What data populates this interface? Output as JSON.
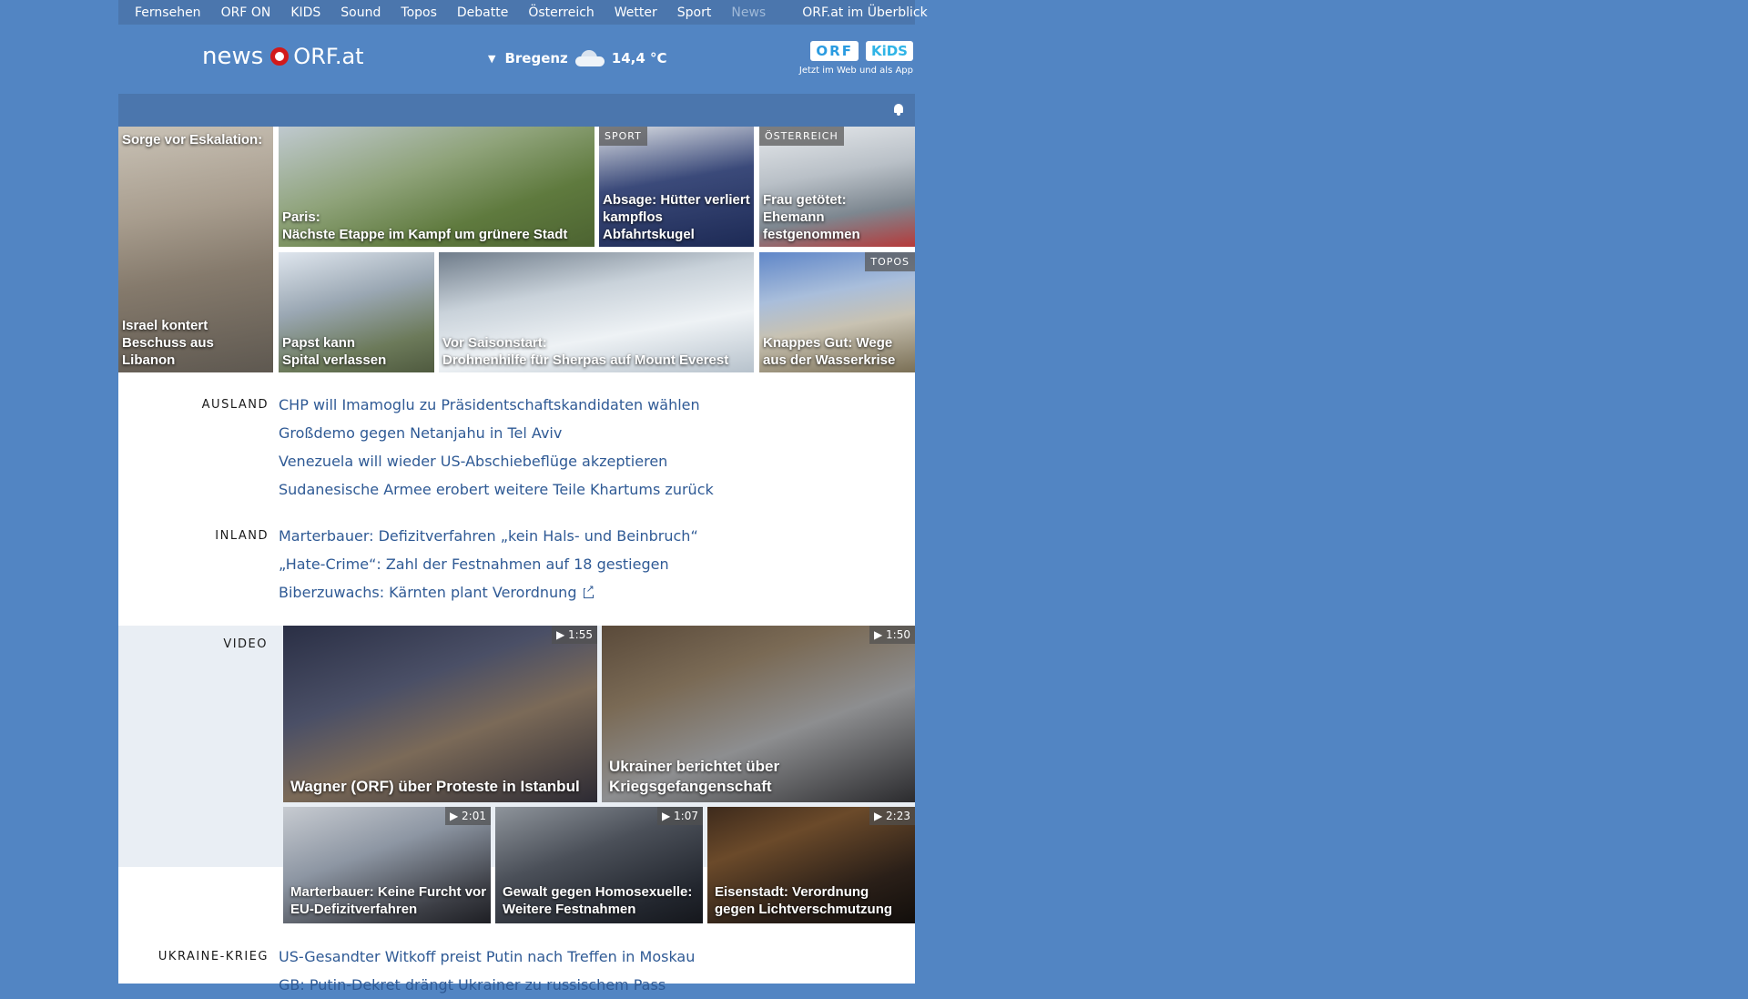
{
  "topnav": {
    "items": [
      "Fernsehen",
      "ORF ON",
      "KIDS",
      "Sound",
      "Topos",
      "Debatte",
      "Österreich",
      "Wetter",
      "Sport",
      "News"
    ],
    "overview": "ORF.at im Überblick"
  },
  "header": {
    "logo_news": "news",
    "logo_orf": "ORF.at",
    "weather_city": "Bregenz",
    "weather_temp": "14,4 °C",
    "kids_orf": "ORF",
    "kids_kids": "KiDS",
    "kids_tagline": "Jetzt im Web und als App"
  },
  "tiles": [
    {
      "top": "Sorge vor Eskalation:",
      "caption": "Israel kontert Beschuss aus Libanon",
      "label": ""
    },
    {
      "caption_l1": "Paris:",
      "caption_l2": "Nächste Etappe im Kampf um grünere Stadt",
      "label": ""
    },
    {
      "caption": "Absage: Hütter verliert kampflos Abfahrtskugel",
      "label": "SPORT"
    },
    {
      "caption": "Frau getötet: Ehemann festgenommen",
      "label": "ÖSTERREICH"
    },
    {
      "caption_l1": "Papst kann",
      "caption_l2": "Spital verlassen",
      "label": ""
    },
    {
      "caption_l1": "Vor Saisonstart:",
      "caption_l2": "Drohnenhilfe für Sherpas auf Mount Everest",
      "label": ""
    },
    {
      "caption": "Knappes Gut: Wege aus der Wasserkrise",
      "label": "TOPOS"
    }
  ],
  "sections": {
    "ausland": {
      "label": "AUSLAND",
      "links": [
        "CHP will Imamoglu zu Präsidentschaftskandidaten wählen",
        "Großdemo gegen Netanjahu in Tel Aviv",
        "Venezuela will wieder US-Abschiebeflüge akzeptieren",
        "Sudanesische Armee erobert weitere Teile Khartums zurück"
      ]
    },
    "inland": {
      "label": "INLAND",
      "links": [
        "Marterbauer: Defizitverfahren „kein Hals- und Beinbruch“",
        "„Hate-Crime“: Zahl der Festnahmen auf 18 gestiegen",
        "Biberzuwachs: Kärnten plant Verordnung"
      ]
    },
    "video": {
      "label": "VIDEO",
      "items": [
        {
          "caption": "Wagner (ORF) über Proteste in Istanbul",
          "duration": "1:55"
        },
        {
          "caption": "Ukrainer berichtet über Kriegsgefangenschaft",
          "duration": "1:50"
        },
        {
          "caption": "Marterbauer: Keine Furcht vor EU-Defizitverfahren",
          "duration": "2:01"
        },
        {
          "caption": "Gewalt gegen Homosexuelle: Weitere Festnahmen",
          "duration": "1:07"
        },
        {
          "caption": "Eisenstadt: Verordnung gegen Lichtverschmutzung",
          "duration": "2:23"
        }
      ]
    },
    "ukraine": {
      "label": "UKRAINE-KRIEG",
      "links": [
        "US-Gesandter Witkoff preist Putin nach Treffen in Moskau",
        "GB: Putin-Dekret drängt Ukrainer zu russischem Pass"
      ]
    }
  },
  "colors": {
    "page_bg": "#5285c3",
    "nav_bg": "#4b76ad",
    "link": "#2f5a95",
    "orf_red": "#d21a1a"
  }
}
